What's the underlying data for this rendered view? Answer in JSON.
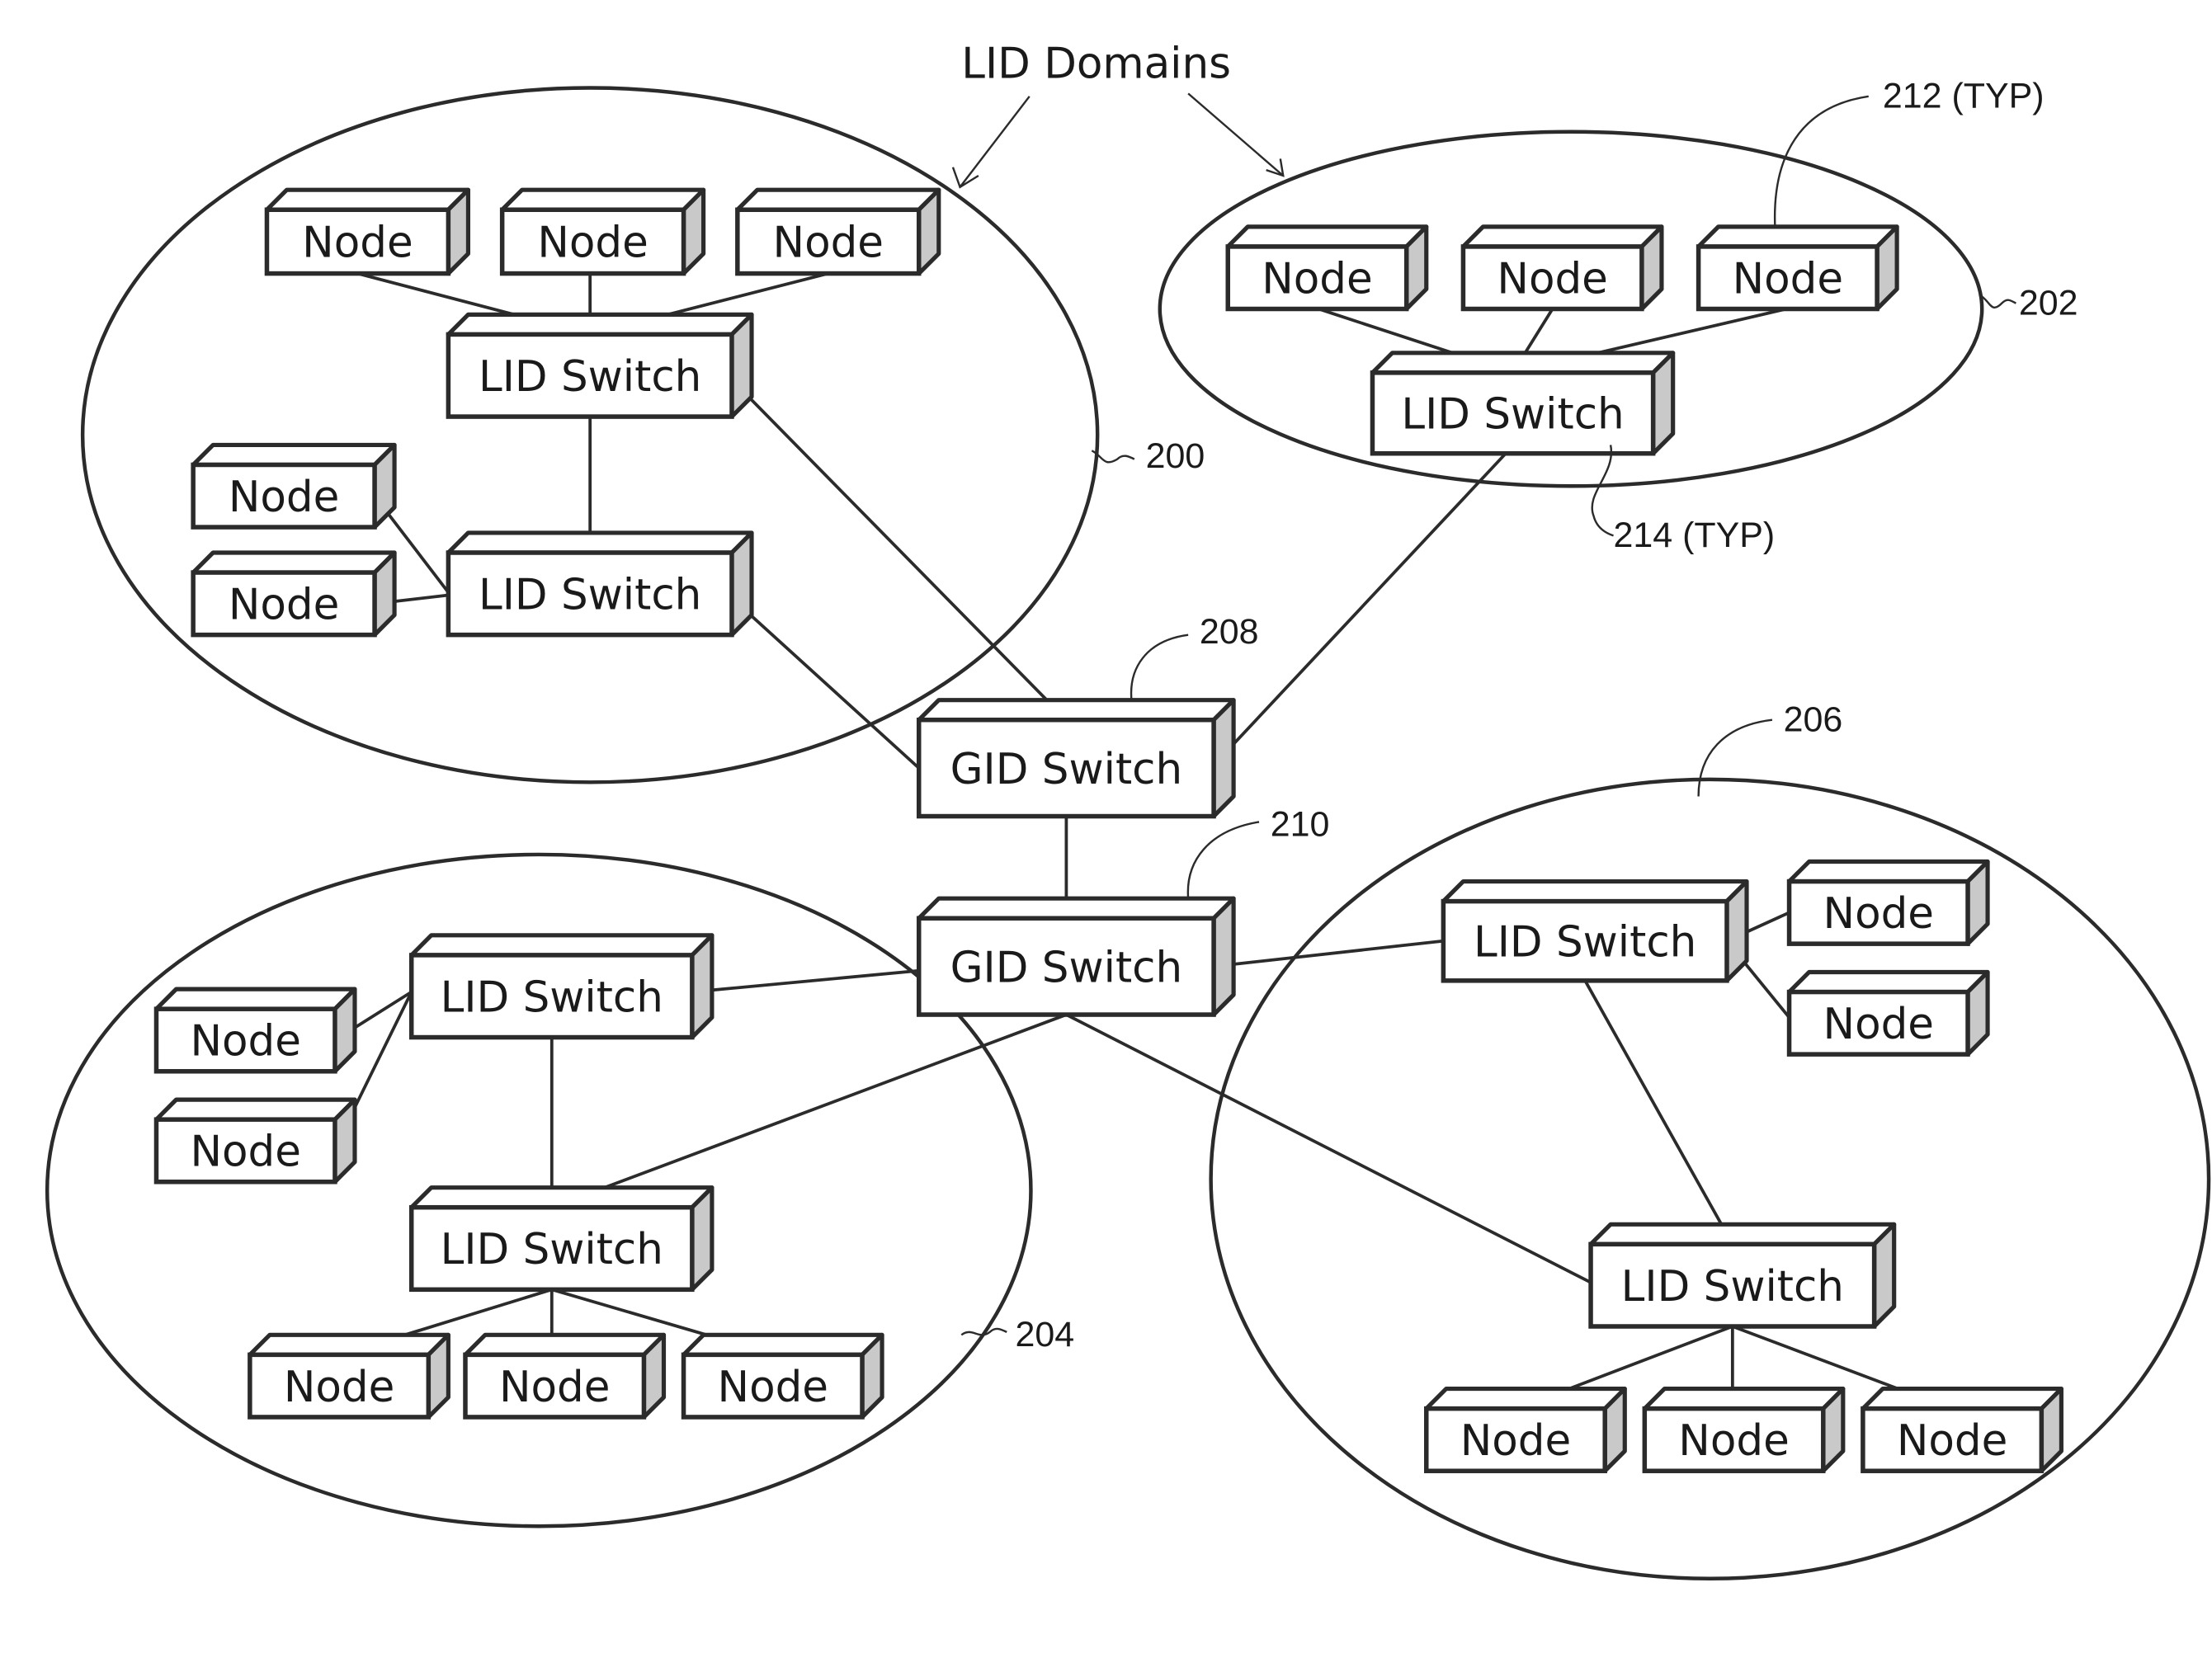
{
  "figure": {
    "title": "LID Domains",
    "reference_labels": {
      "domain_200": "200",
      "domain_202": "202",
      "domain_204": "204",
      "domain_206": "206",
      "gid_switch_208": "208",
      "gid_switch_210": "210",
      "typ_node_212": "212 (TYP)",
      "typ_switch_214": "214 (TYP)"
    }
  },
  "labels": {
    "node": "Node",
    "lid_switch": "LID Switch",
    "gid_switch": "GID Switch"
  },
  "domains": [
    {
      "id": "200",
      "lid_switches": 2,
      "nodes": 5
    },
    {
      "id": "202",
      "lid_switches": 1,
      "nodes": 3
    },
    {
      "id": "204",
      "lid_switches": 2,
      "nodes": 5
    },
    {
      "id": "206",
      "lid_switches": 2,
      "nodes": 5
    }
  ],
  "gid_switches": [
    {
      "id": "208"
    },
    {
      "id": "210"
    }
  ]
}
